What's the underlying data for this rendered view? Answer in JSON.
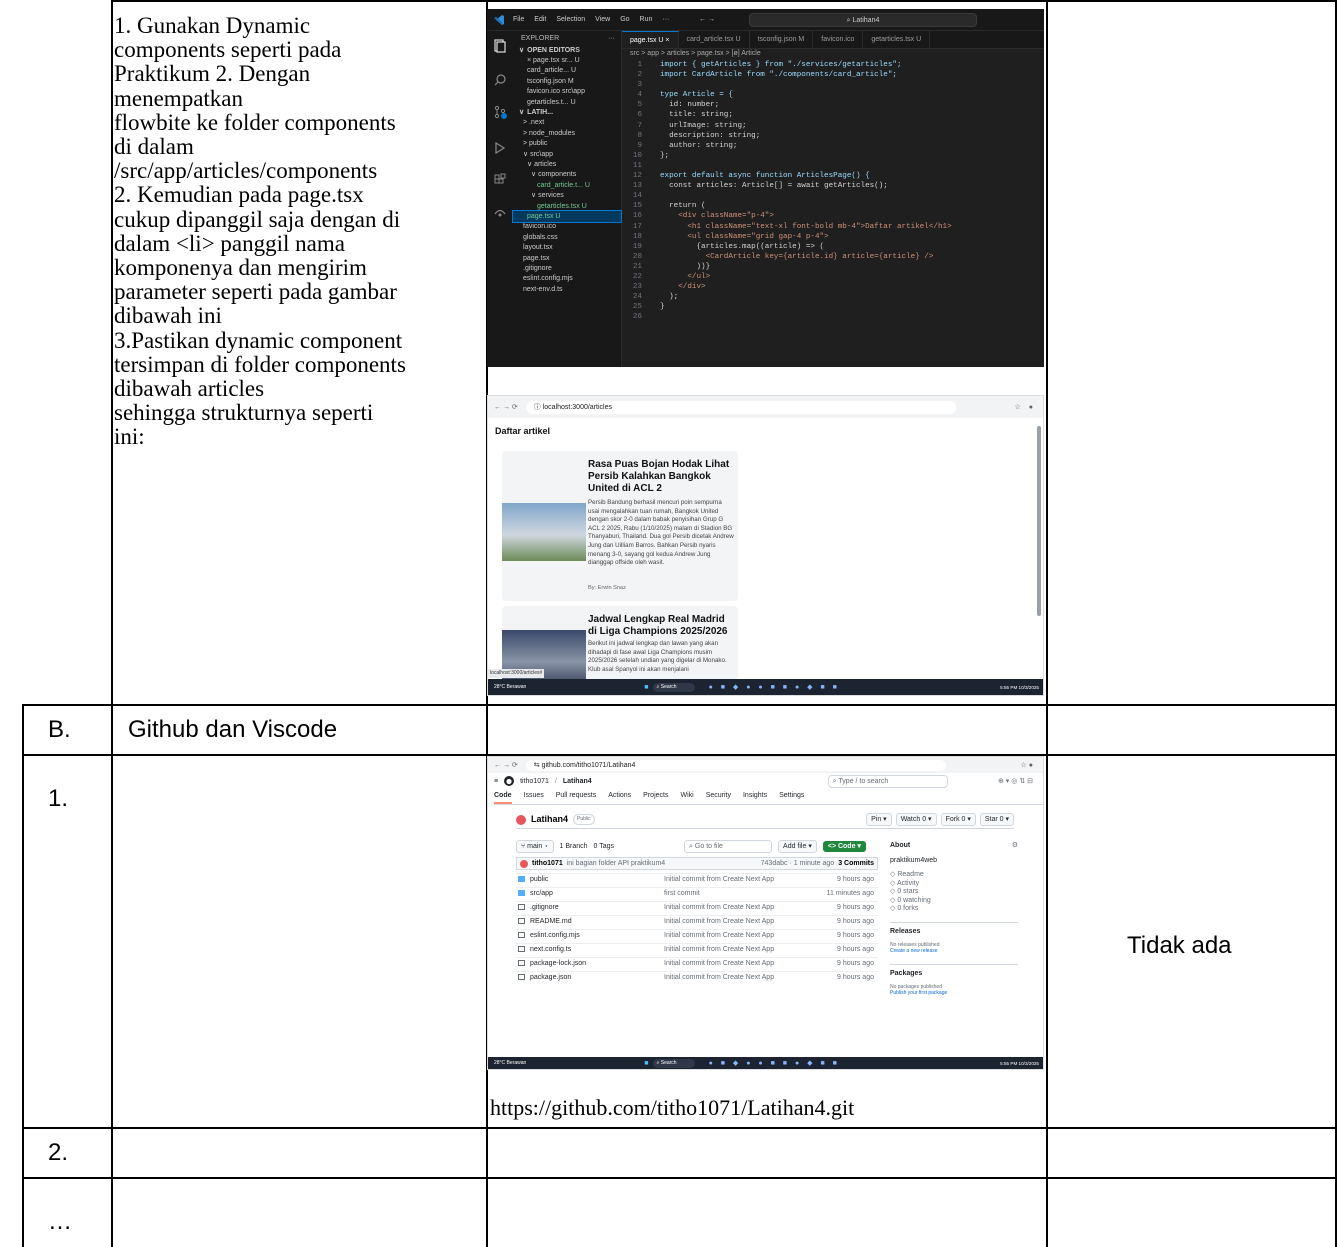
{
  "row_a": {
    "instructions_lines": [
      "1. Gunakan Dynamic",
      "components seperti pada",
      "Praktikum 2. Dengan",
      "menempatkan",
      "flowbite ke folder components",
      "di dalam",
      "/src/app/articles/components",
      "2. Kemudian pada page.tsx",
      "cukup dipanggil saja dengan di",
      "dalam <li> panggil nama",
      "komponenya dan mengirim",
      "parameter seperti pada gambar",
      "dibawah ini",
      "3.Pastikan dynamic component",
      "tersimpan di folder components",
      "dibawah articles",
      "sehingga strukturnya seperti",
      "ini:"
    ]
  },
  "row_b": {
    "number": "B.",
    "title": "Github dan Viscode"
  },
  "row_1": {
    "number": "1.",
    "link": "https://github.com/titho1071/Latihan4.git",
    "note": "Tidak ada"
  },
  "row_2": {
    "number": "2."
  },
  "row_3": {
    "number": "…"
  },
  "vscode": {
    "menu": [
      "File",
      "Edit",
      "Selection",
      "View",
      "Go",
      "Run",
      "···"
    ],
    "search": "Latihan4",
    "tabs": [
      "page.tsx U ×",
      "card_article.tsx U",
      "tsconfig.json M",
      "favicon.ico",
      "getarticles.tsx U"
    ],
    "breadcrumb": "src > app > articles > page.tsx > [ø] Article",
    "explorer_title": "EXPLORER",
    "open_editors": "OPEN EDITORS",
    "open_files": [
      "× page.tsx sr... U",
      "card_article... U",
      "tsconfig.json M",
      "favicon.ico src\\app",
      "getarticles.t... U"
    ],
    "project": "LATIH...",
    "tree": [
      "> .next",
      "> node_modules",
      "> public",
      "∨ src\\app",
      "∨ articles",
      "∨ components",
      "card_article.t... U",
      "∨ services",
      "getarticles.tsx U",
      "page.tsx          U",
      "favicon.ico",
      "globals.css",
      "layout.tsx",
      "page.tsx",
      ".gitignore",
      "eslint.config.mjs",
      "next-env.d.ts"
    ],
    "code_lines": [
      "import { getArticles } from \"./services/getarticles\";",
      "import CardArticle from \"./components/card_article\";",
      "",
      "type Article = {",
      "  id: number;",
      "  title: string;",
      "  urlImage: string;",
      "  description: string;",
      "  author: string;",
      "};",
      "",
      "export default async function ArticlesPage() {",
      "  const articles: Article[] = await getArticles();",
      "",
      "  return (",
      "    <div className=\"p-4\">",
      "      <h1 className=\"text-xl font-bold mb-4\">Daftar artikel</h1>",
      "      <ul className=\"grid gap-4 p-4\">",
      "        {articles.map((article) => (",
      "          <CardArticle key={article.id} article={article} />",
      "        ))}",
      "      </ul>",
      "    </div>",
      "  );",
      "}",
      ""
    ]
  },
  "browser1": {
    "url": "localhost:3000/articles",
    "heading": "Daftar artikel",
    "cards": [
      {
        "title": "Rasa Puas Bojan Hodak Lihat Persib Kalahkan Bangkok United di ACL 2",
        "description": "Persib Bandung berhasil mencuri poin sempurna usai mengalahkan tuan rumah, Bangkok United dengan skor 2-0 dalam babak penyisihan Grup G ACL 2 2025, Rabu (1/10/2025) malam di Stadion BG Thanyaburi, Thailand. Dua gol Persib dicetak Andrew Jung dan Uilliam Barros. Bahkan Persib nyaris menang 3-0, sayang gol kedua Andrew Jung dianggap offside oleh wasit.",
        "author": "By: Erwin Snaz"
      },
      {
        "title": "Jadwal Lengkap Real Madrid di Liga Champions 2025/2026",
        "description": "Berikut ini jadwal lengkap dan lawan yang akan dihadapi di fase awal Liga Champions musim 2025/2026 setelah undian yang digelar di Monako. Klub asal Spanyol ini akan menjalani",
        "author": ""
      }
    ],
    "status_url": "localhost:3000/articles#",
    "weather": "28°C Berawan",
    "search": "Search",
    "clock": "5:55 PM 10/3/2025"
  },
  "github": {
    "url": "github.com/titho1071/Latihan4",
    "owner": "titho1071",
    "repo": "Latihan4",
    "search": "Type / to search",
    "nav": [
      "Code",
      "Issues",
      "Pull requests",
      "Actions",
      "Projects",
      "Wiki",
      "Security",
      "Insights",
      "Settings"
    ],
    "visibility": "Public",
    "repo_buttons": [
      "Pin",
      "Watch 0",
      "Fork 0",
      "Star 0"
    ],
    "branch": "main",
    "branch_count": "1 Branch",
    "tag_count": "0 Tags",
    "goto_file": "Go to file",
    "add_file": "Add file",
    "code_button": "<> Code",
    "last_commit": {
      "author": "titho1071",
      "message": "ini bagian folder API praktikum4",
      "hash": "743dabc · 1 minute ago",
      "commits": "3 Commits"
    },
    "files": [
      {
        "name": "public",
        "msg": "Initial commit from Create Next App",
        "time": "9 hours ago",
        "kind": "folder"
      },
      {
        "name": "src/app",
        "msg": "first commit",
        "time": "11 minutes ago",
        "kind": "folder"
      },
      {
        "name": ".gitignore",
        "msg": "Initial commit from Create Next App",
        "time": "9 hours ago",
        "kind": "file"
      },
      {
        "name": "README.md",
        "msg": "Initial commit from Create Next App",
        "time": "9 hours ago",
        "kind": "file"
      },
      {
        "name": "eslint.config.mjs",
        "msg": "Initial commit from Create Next App",
        "time": "9 hours ago",
        "kind": "file"
      },
      {
        "name": "next.config.ts",
        "msg": "Initial commit from Create Next App",
        "time": "9 hours ago",
        "kind": "file"
      },
      {
        "name": "package-lock.json",
        "msg": "Initial commit from Create Next App",
        "time": "9 hours ago",
        "kind": "file"
      },
      {
        "name": "package.json",
        "msg": "Initial commit from Create Next App",
        "time": "9 hours ago",
        "kind": "file"
      }
    ],
    "about": {
      "title": "About",
      "description": "praktikum4web",
      "items": [
        "Readme",
        "Activity",
        "0 stars",
        "0 watching",
        "0 forks"
      ],
      "releases_title": "Releases",
      "releases_text": "No releases published",
      "releases_link": "Create a new release",
      "packages_title": "Packages",
      "packages_text": "No packages published",
      "packages_link": "Publish your first package"
    },
    "weather": "28°C Berawan",
    "search_task": "Search",
    "clock": "5:55 PM 10/3/2025"
  }
}
